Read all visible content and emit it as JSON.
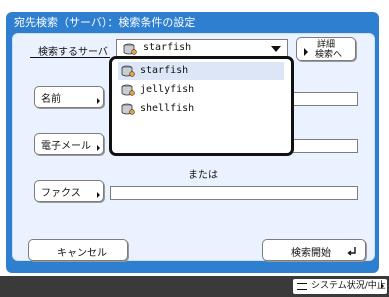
{
  "window": {
    "title": "宛先検索（サーバ）：検索条件の設定"
  },
  "server": {
    "label": "検索するサーバ",
    "selected": "starfish"
  },
  "details_button": {
    "label_line1": "詳細",
    "label_line2": "検索へ"
  },
  "server_options": [
    {
      "label": "starfish",
      "icon": "server-database-icon",
      "selected": true
    },
    {
      "label": "jellyfish",
      "icon": "server-database-icon",
      "selected": false
    },
    {
      "label": "shellfish",
      "icon": "server-database-icon",
      "selected": false
    }
  ],
  "fields": {
    "name_label": "名前",
    "email_label": "電子メール",
    "or_text": "または",
    "fax_label": "ファクス"
  },
  "footer": {
    "cancel_label": "キャンセル",
    "start_label": "検索開始"
  },
  "status": {
    "label": "システム状況/中止"
  },
  "colors": {
    "frame": "#2f7fd1",
    "panel": "#eaf2ff",
    "status_bar": "#3a3a3a",
    "selected_option": "#dce6f7"
  }
}
